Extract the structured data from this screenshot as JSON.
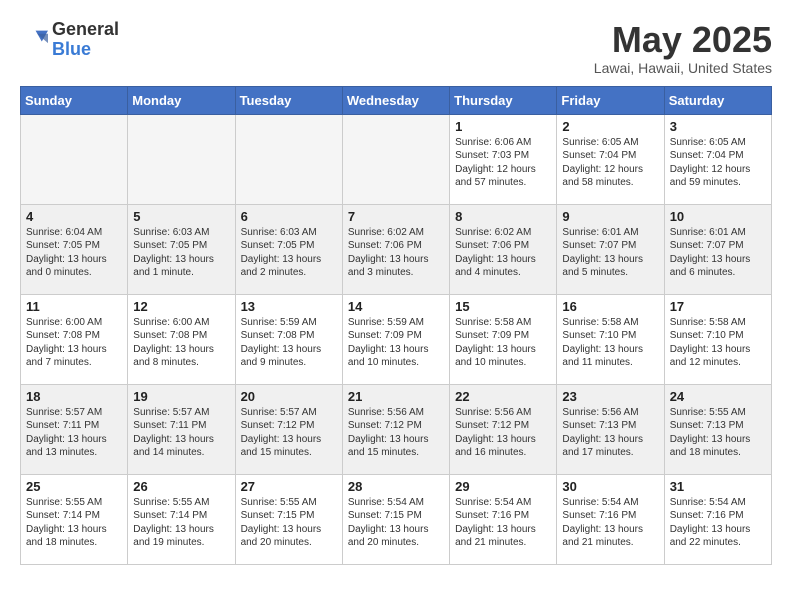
{
  "header": {
    "logo_general": "General",
    "logo_blue": "Blue",
    "month_title": "May 2025",
    "location": "Lawai, Hawaii, United States"
  },
  "weekdays": [
    "Sunday",
    "Monday",
    "Tuesday",
    "Wednesday",
    "Thursday",
    "Friday",
    "Saturday"
  ],
  "weeks": [
    [
      {
        "day": "",
        "info": ""
      },
      {
        "day": "",
        "info": ""
      },
      {
        "day": "",
        "info": ""
      },
      {
        "day": "",
        "info": ""
      },
      {
        "day": "1",
        "info": "Sunrise: 6:06 AM\nSunset: 7:03 PM\nDaylight: 12 hours\nand 57 minutes."
      },
      {
        "day": "2",
        "info": "Sunrise: 6:05 AM\nSunset: 7:04 PM\nDaylight: 12 hours\nand 58 minutes."
      },
      {
        "day": "3",
        "info": "Sunrise: 6:05 AM\nSunset: 7:04 PM\nDaylight: 12 hours\nand 59 minutes."
      }
    ],
    [
      {
        "day": "4",
        "info": "Sunrise: 6:04 AM\nSunset: 7:05 PM\nDaylight: 13 hours\nand 0 minutes."
      },
      {
        "day": "5",
        "info": "Sunrise: 6:03 AM\nSunset: 7:05 PM\nDaylight: 13 hours\nand 1 minute."
      },
      {
        "day": "6",
        "info": "Sunrise: 6:03 AM\nSunset: 7:05 PM\nDaylight: 13 hours\nand 2 minutes."
      },
      {
        "day": "7",
        "info": "Sunrise: 6:02 AM\nSunset: 7:06 PM\nDaylight: 13 hours\nand 3 minutes."
      },
      {
        "day": "8",
        "info": "Sunrise: 6:02 AM\nSunset: 7:06 PM\nDaylight: 13 hours\nand 4 minutes."
      },
      {
        "day": "9",
        "info": "Sunrise: 6:01 AM\nSunset: 7:07 PM\nDaylight: 13 hours\nand 5 minutes."
      },
      {
        "day": "10",
        "info": "Sunrise: 6:01 AM\nSunset: 7:07 PM\nDaylight: 13 hours\nand 6 minutes."
      }
    ],
    [
      {
        "day": "11",
        "info": "Sunrise: 6:00 AM\nSunset: 7:08 PM\nDaylight: 13 hours\nand 7 minutes."
      },
      {
        "day": "12",
        "info": "Sunrise: 6:00 AM\nSunset: 7:08 PM\nDaylight: 13 hours\nand 8 minutes."
      },
      {
        "day": "13",
        "info": "Sunrise: 5:59 AM\nSunset: 7:08 PM\nDaylight: 13 hours\nand 9 minutes."
      },
      {
        "day": "14",
        "info": "Sunrise: 5:59 AM\nSunset: 7:09 PM\nDaylight: 13 hours\nand 10 minutes."
      },
      {
        "day": "15",
        "info": "Sunrise: 5:58 AM\nSunset: 7:09 PM\nDaylight: 13 hours\nand 10 minutes."
      },
      {
        "day": "16",
        "info": "Sunrise: 5:58 AM\nSunset: 7:10 PM\nDaylight: 13 hours\nand 11 minutes."
      },
      {
        "day": "17",
        "info": "Sunrise: 5:58 AM\nSunset: 7:10 PM\nDaylight: 13 hours\nand 12 minutes."
      }
    ],
    [
      {
        "day": "18",
        "info": "Sunrise: 5:57 AM\nSunset: 7:11 PM\nDaylight: 13 hours\nand 13 minutes."
      },
      {
        "day": "19",
        "info": "Sunrise: 5:57 AM\nSunset: 7:11 PM\nDaylight: 13 hours\nand 14 minutes."
      },
      {
        "day": "20",
        "info": "Sunrise: 5:57 AM\nSunset: 7:12 PM\nDaylight: 13 hours\nand 15 minutes."
      },
      {
        "day": "21",
        "info": "Sunrise: 5:56 AM\nSunset: 7:12 PM\nDaylight: 13 hours\nand 15 minutes."
      },
      {
        "day": "22",
        "info": "Sunrise: 5:56 AM\nSunset: 7:12 PM\nDaylight: 13 hours\nand 16 minutes."
      },
      {
        "day": "23",
        "info": "Sunrise: 5:56 AM\nSunset: 7:13 PM\nDaylight: 13 hours\nand 17 minutes."
      },
      {
        "day": "24",
        "info": "Sunrise: 5:55 AM\nSunset: 7:13 PM\nDaylight: 13 hours\nand 18 minutes."
      }
    ],
    [
      {
        "day": "25",
        "info": "Sunrise: 5:55 AM\nSunset: 7:14 PM\nDaylight: 13 hours\nand 18 minutes."
      },
      {
        "day": "26",
        "info": "Sunrise: 5:55 AM\nSunset: 7:14 PM\nDaylight: 13 hours\nand 19 minutes."
      },
      {
        "day": "27",
        "info": "Sunrise: 5:55 AM\nSunset: 7:15 PM\nDaylight: 13 hours\nand 20 minutes."
      },
      {
        "day": "28",
        "info": "Sunrise: 5:54 AM\nSunset: 7:15 PM\nDaylight: 13 hours\nand 20 minutes."
      },
      {
        "day": "29",
        "info": "Sunrise: 5:54 AM\nSunset: 7:16 PM\nDaylight: 13 hours\nand 21 minutes."
      },
      {
        "day": "30",
        "info": "Sunrise: 5:54 AM\nSunset: 7:16 PM\nDaylight: 13 hours\nand 21 minutes."
      },
      {
        "day": "31",
        "info": "Sunrise: 5:54 AM\nSunset: 7:16 PM\nDaylight: 13 hours\nand 22 minutes."
      }
    ]
  ]
}
